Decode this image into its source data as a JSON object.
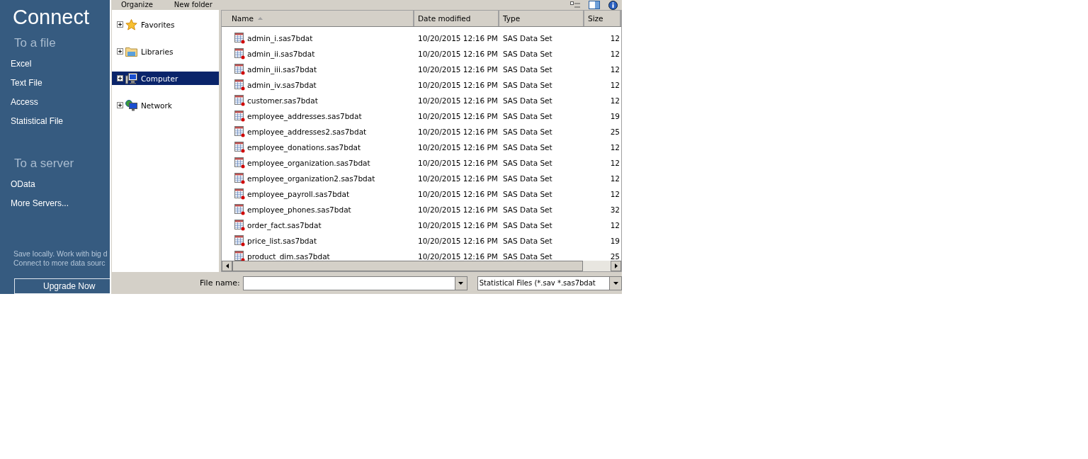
{
  "sidebar": {
    "title": "Connect",
    "sections": [
      {
        "heading": "To a file",
        "items": [
          "Excel",
          "Text File",
          "Access",
          "Statistical File"
        ]
      },
      {
        "heading": "To a server",
        "items": [
          "OData",
          "More Servers..."
        ]
      }
    ],
    "promo_lines": [
      "Save locally. Work with big d",
      "Connect to more data sourc"
    ],
    "upgrade_button": "Upgrade Now"
  },
  "toolbar": {
    "buttons": [
      "Organize",
      "New folder"
    ]
  },
  "navigation": [
    {
      "label": "Favorites",
      "kind": "star",
      "expanded": false,
      "selected": false
    },
    {
      "label": "Libraries",
      "kind": "folder",
      "expanded": false,
      "selected": false
    },
    {
      "label": "Computer",
      "kind": "computer",
      "expanded": false,
      "selected": true
    },
    {
      "label": "Network",
      "kind": "network",
      "expanded": false,
      "selected": false
    }
  ],
  "table": {
    "columns": [
      {
        "label": "Name",
        "sorted": true
      },
      {
        "label": "Date modified",
        "sorted": false
      },
      {
        "label": "Type",
        "sorted": false
      },
      {
        "label": "Size",
        "sorted": false
      }
    ],
    "rows": [
      [
        "admin_i.sas7bdat",
        "10/20/2015 12:16 PM",
        "SAS Data Set",
        "12"
      ],
      [
        "admin_ii.sas7bdat",
        "10/20/2015 12:16 PM",
        "SAS Data Set",
        "12"
      ],
      [
        "admin_iii.sas7bdat",
        "10/20/2015 12:16 PM",
        "SAS Data Set",
        "12"
      ],
      [
        "admin_iv.sas7bdat",
        "10/20/2015 12:16 PM",
        "SAS Data Set",
        "12"
      ],
      [
        "customer.sas7bdat",
        "10/20/2015 12:16 PM",
        "SAS Data Set",
        "12"
      ],
      [
        "employee_addresses.sas7bdat",
        "10/20/2015 12:16 PM",
        "SAS Data Set",
        "19"
      ],
      [
        "employee_addresses2.sas7bdat",
        "10/20/2015 12:16 PM",
        "SAS Data Set",
        "25"
      ],
      [
        "employee_donations.sas7bdat",
        "10/20/2015 12:16 PM",
        "SAS Data Set",
        "12"
      ],
      [
        "employee_organization.sas7bdat",
        "10/20/2015 12:16 PM",
        "SAS Data Set",
        "12"
      ],
      [
        "employee_organization2.sas7bdat",
        "10/20/2015 12:16 PM",
        "SAS Data Set",
        "12"
      ],
      [
        "employee_payroll.sas7bdat",
        "10/20/2015 12:16 PM",
        "SAS Data Set",
        "12"
      ],
      [
        "employee_phones.sas7bdat",
        "10/20/2015 12:16 PM",
        "SAS Data Set",
        "32"
      ],
      [
        "order_fact.sas7bdat",
        "10/20/2015 12:16 PM",
        "SAS Data Set",
        "12"
      ],
      [
        "price_list.sas7bdat",
        "10/20/2015 12:16 PM",
        "SAS Data Set",
        "19"
      ],
      [
        "product_dim.sas7bdat",
        "10/20/2015 12:16 PM",
        "SAS Data Set",
        "25"
      ]
    ]
  },
  "file_name": {
    "label": "File name:"
  },
  "file_type": {
    "value": "Statistical Files (*.sav *.sas7bdat"
  }
}
